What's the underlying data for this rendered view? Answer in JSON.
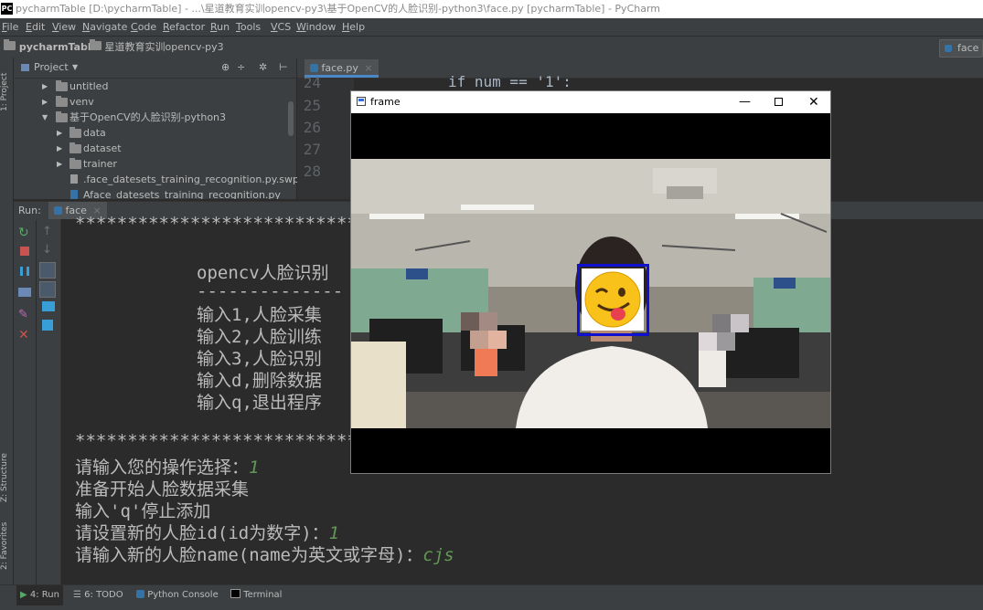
{
  "window": {
    "title": "pycharmTable [D:\\pycharmTable] - ...\\星道教育实训opencv-py3\\基于OpenCV的人脸识别-python3\\face.py [pycharmTable] - PyCharm"
  },
  "menu": [
    "File",
    "Edit",
    "View",
    "Navigate",
    "Code",
    "Refactor",
    "Run",
    "Tools",
    "VCS",
    "Window",
    "Help"
  ],
  "breadcrumb": {
    "project": "pycharmTable",
    "folder": "星道教育实训opencv-py3",
    "run_config": "face"
  },
  "left_stripe": {
    "project_tab": "1: Project",
    "structure_tab": "Z: Structure",
    "favorites_tab": "2: Favorites"
  },
  "project_panel": {
    "title": "Project",
    "tree": [
      {
        "label": "untitled"
      },
      {
        "label": "venv"
      },
      {
        "label": "基于OpenCV的人脸识别-python3"
      },
      {
        "label": "data"
      },
      {
        "label": "dataset"
      },
      {
        "label": "trainer"
      },
      {
        "label": ".face_datesets_training_recognition.py.swp"
      },
      {
        "label": "Aface_datesets_training_recognition.py"
      }
    ]
  },
  "editor": {
    "tab": "face.py",
    "line_numbers": [
      "24",
      "25",
      "26",
      "27",
      "28"
    ],
    "code_visible": "if num == '1':"
  },
  "run": {
    "label": "Run:",
    "tab": "face"
  },
  "console": {
    "stars": "***********************************************",
    "menu_title": "opencv人脸识别",
    "dashes": "--------------",
    "options": [
      "输入1,人脸采集",
      "输入2,人脸训练",
      "输入3,人脸识别",
      "输入d,删除数据",
      "输入q,退出程序"
    ],
    "prompt_choice": "请输入您的操作选择：",
    "choice_value": "1",
    "start_msg": "准备开始人脸数据采集",
    "stop_msg": "输入'q'停止添加",
    "prompt_id": "请设置新的人脸id(id为数字)：",
    "id_value": "1",
    "prompt_name": "请输入新的人脸name(name为英文或字母)：",
    "name_value": "cjs"
  },
  "frame_window": {
    "title": "frame"
  },
  "bottom_tabs": [
    "4: Run",
    "6: TODO",
    "Python Console",
    "Terminal"
  ],
  "colors": {
    "ide_bg": "#2b2b2b",
    "panel_bg": "#3c3f41",
    "input_text": "#629755",
    "detect_box": "#1010d0"
  }
}
